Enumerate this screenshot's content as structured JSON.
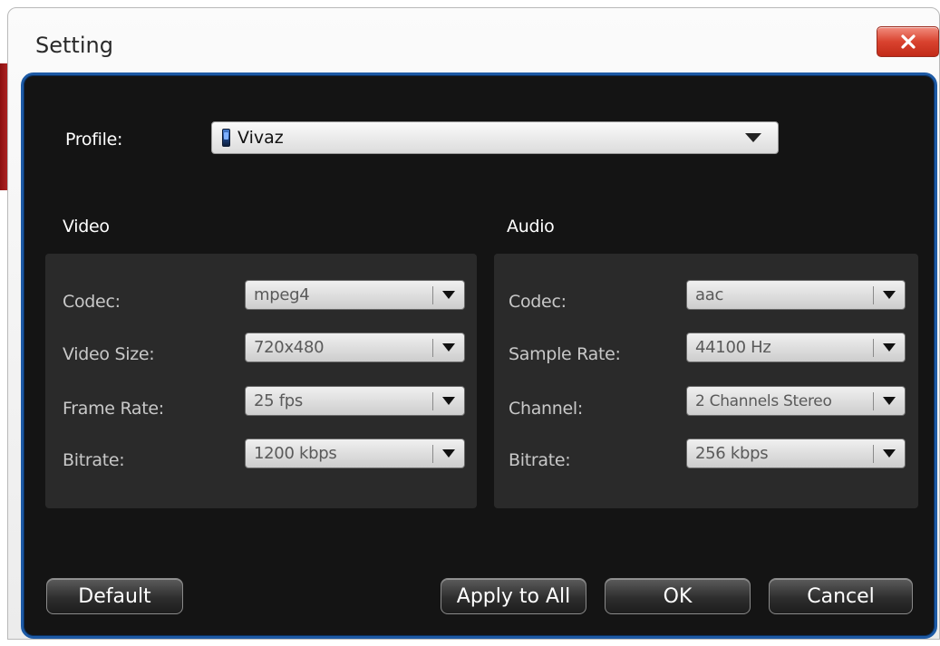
{
  "window": {
    "title": "Setting"
  },
  "profile": {
    "label": "Profile:",
    "value": "Vivaz",
    "icon": "phone-icon"
  },
  "video": {
    "heading": "Video",
    "fields": [
      {
        "label": "Codec:",
        "value": "mpeg4"
      },
      {
        "label": "Video Size:",
        "value": "720x480"
      },
      {
        "label": "Frame Rate:",
        "value": "25 fps"
      },
      {
        "label": "Bitrate:",
        "value": "1200 kbps"
      }
    ]
  },
  "audio": {
    "heading": "Audio",
    "fields": [
      {
        "label": "Codec:",
        "value": "aac"
      },
      {
        "label": "Sample Rate:",
        "value": "44100 Hz"
      },
      {
        "label": "Channel:",
        "value": "2 Channels Stereo"
      },
      {
        "label": "Bitrate:",
        "value": "256 kbps"
      }
    ]
  },
  "buttons": {
    "default": "Default",
    "apply_all": "Apply to All",
    "ok": "OK",
    "cancel": "Cancel"
  },
  "colors": {
    "accent_border": "#1d5aa5",
    "close_button": "#d9432f",
    "panel_bg": "#141414"
  }
}
